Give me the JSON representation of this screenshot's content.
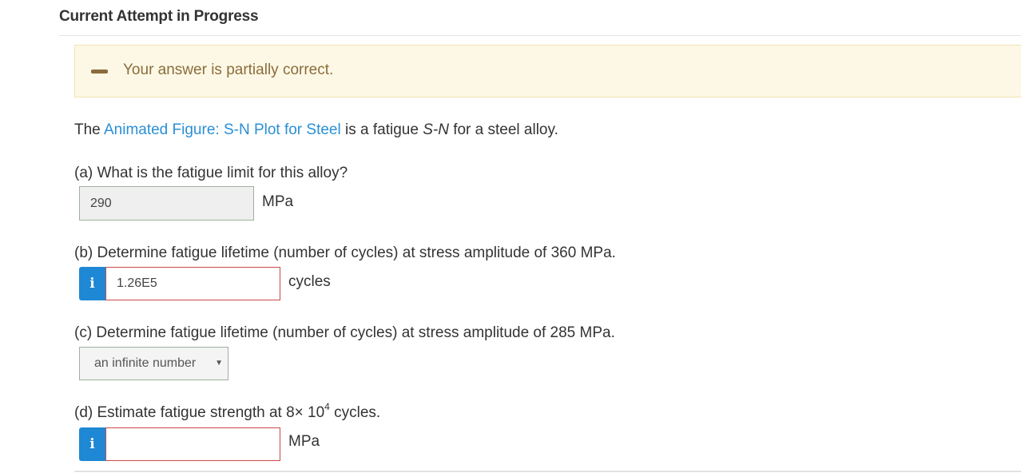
{
  "header": {
    "title": "Current Attempt in Progress"
  },
  "feedback": {
    "message": "Your answer is partially correct.",
    "status_color": "#8a6d3b",
    "background_color": "#fdf8e6"
  },
  "intro": {
    "prefix": "The ",
    "link_text": "Animated Figure: S-N Plot for Steel",
    "middle": " is a fatigue ",
    "italic_text": "S-N",
    "suffix": " for a steel alloy."
  },
  "questions": {
    "a": {
      "prompt": "(a) What is the fatigue limit for this alloy?",
      "value": "290",
      "unit": "MPa"
    },
    "b": {
      "prompt": "(b) Determine fatigue lifetime (number of cycles) at stress amplitude of 360 MPa.",
      "info_label": "i",
      "value": "1.26E5",
      "unit": "cycles"
    },
    "c": {
      "prompt": "(c) Determine fatigue lifetime (number of cycles) at stress amplitude of 285 MPa.",
      "selected_option": "an infinite number",
      "arrow": "▼"
    },
    "d": {
      "prompt_prefix": "(d) Estimate fatigue strength at 8× 10",
      "prompt_sup": "4",
      "prompt_suffix": " cycles.",
      "info_label": "i",
      "value": "",
      "unit": "MPa"
    }
  },
  "colors": {
    "link": "#2a8fd6",
    "info_button": "#1e88d4",
    "incorrect_border": "#c94a4a"
  }
}
